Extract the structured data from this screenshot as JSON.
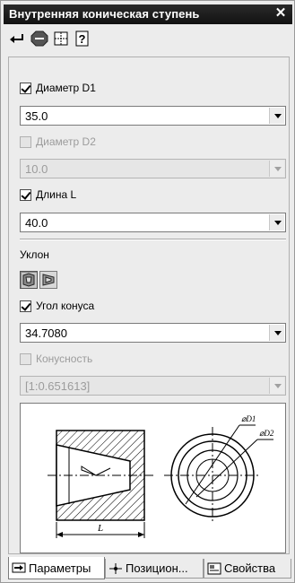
{
  "window": {
    "title": "Внутренняя коническая ступень",
    "close_label": "✕"
  },
  "toolbar": {
    "buttons": [
      "enter-icon",
      "stop-icon",
      "grid-icon",
      "help-icon"
    ]
  },
  "params": {
    "diameter_d1": {
      "label": "Диаметр D1",
      "checked": true,
      "value": "35.0"
    },
    "diameter_d2": {
      "label": "Диаметр D2",
      "checked": false,
      "disabled": true,
      "value": "10.0"
    },
    "length_l": {
      "label": "Длина L",
      "checked": true,
      "value": "40.0"
    },
    "slope": {
      "label": "Уклон"
    },
    "cone_angle": {
      "label": "Угол конуса",
      "checked": true,
      "value": "34.7080"
    },
    "conicity": {
      "label": "Конусность",
      "checked": false,
      "disabled": true,
      "value": "[1:0.651613]"
    }
  },
  "sketch": {
    "label_d1": "⌀D1",
    "label_d2": "⌀D2",
    "label_l": "L"
  },
  "tabs": [
    {
      "label": "Параметры",
      "active": true
    },
    {
      "label": "Позицион...",
      "active": false
    },
    {
      "label": "Свойства",
      "active": false
    }
  ],
  "colors": {
    "titlebar": "#1a1a1a",
    "panel": "#ececec"
  }
}
